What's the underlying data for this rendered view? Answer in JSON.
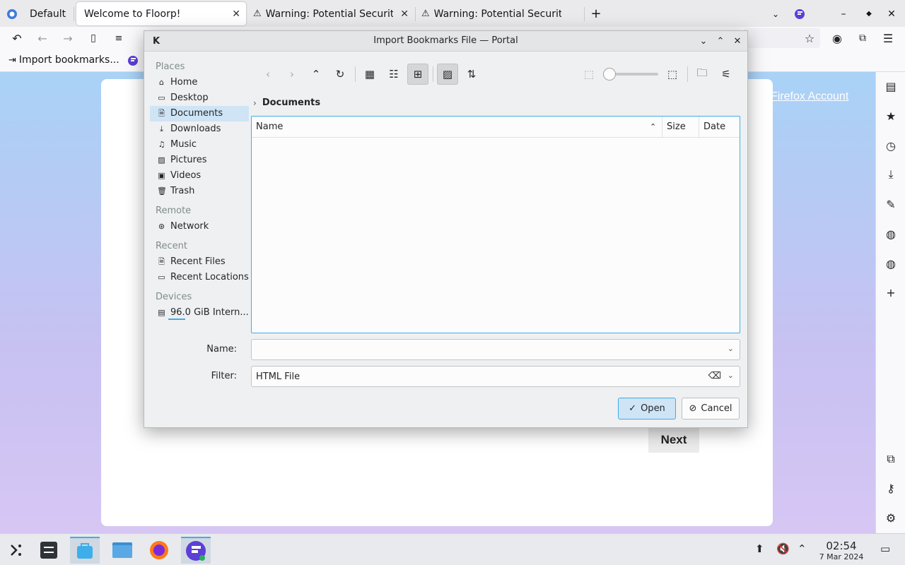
{
  "browser": {
    "tabs": [
      {
        "label": "Default"
      },
      {
        "label": "Welcome to Floorp!",
        "active": true
      },
      {
        "label": "Warning: Potential Security Risk Ahead"
      },
      {
        "label": "Warning: Potential Security Risk Ahead"
      }
    ],
    "new_tab": "+",
    "bookmarks_bar": {
      "import_label": "Import bookmarks..."
    }
  },
  "page": {
    "account_link": "Firefox Account",
    "next_button": "Next"
  },
  "dialog": {
    "title": "Import Bookmarks File — Portal",
    "places": {
      "group_places": "Places",
      "items_places": [
        "Home",
        "Desktop",
        "Documents",
        "Downloads",
        "Music",
        "Pictures",
        "Videos",
        "Trash"
      ],
      "selected": "Documents",
      "group_remote": "Remote",
      "items_remote": [
        "Network"
      ],
      "group_recent": "Recent",
      "items_recent": [
        "Recent Files",
        "Recent Locations"
      ],
      "group_devices": "Devices",
      "items_devices": [
        "96.0 GiB Intern..."
      ]
    },
    "breadcrumb": "Documents",
    "columns": {
      "name": "Name",
      "size": "Size",
      "date": "Date"
    },
    "name_label": "Name:",
    "name_value": "",
    "filter_label": "Filter:",
    "filter_value": "HTML File",
    "open_button": "Open",
    "cancel_button": "Cancel"
  },
  "taskbar": {
    "time": "02:54",
    "date": "7 Mar 2024"
  },
  "colors": {
    "accent": "#3daee9",
    "selection": "#cfe4f5"
  }
}
